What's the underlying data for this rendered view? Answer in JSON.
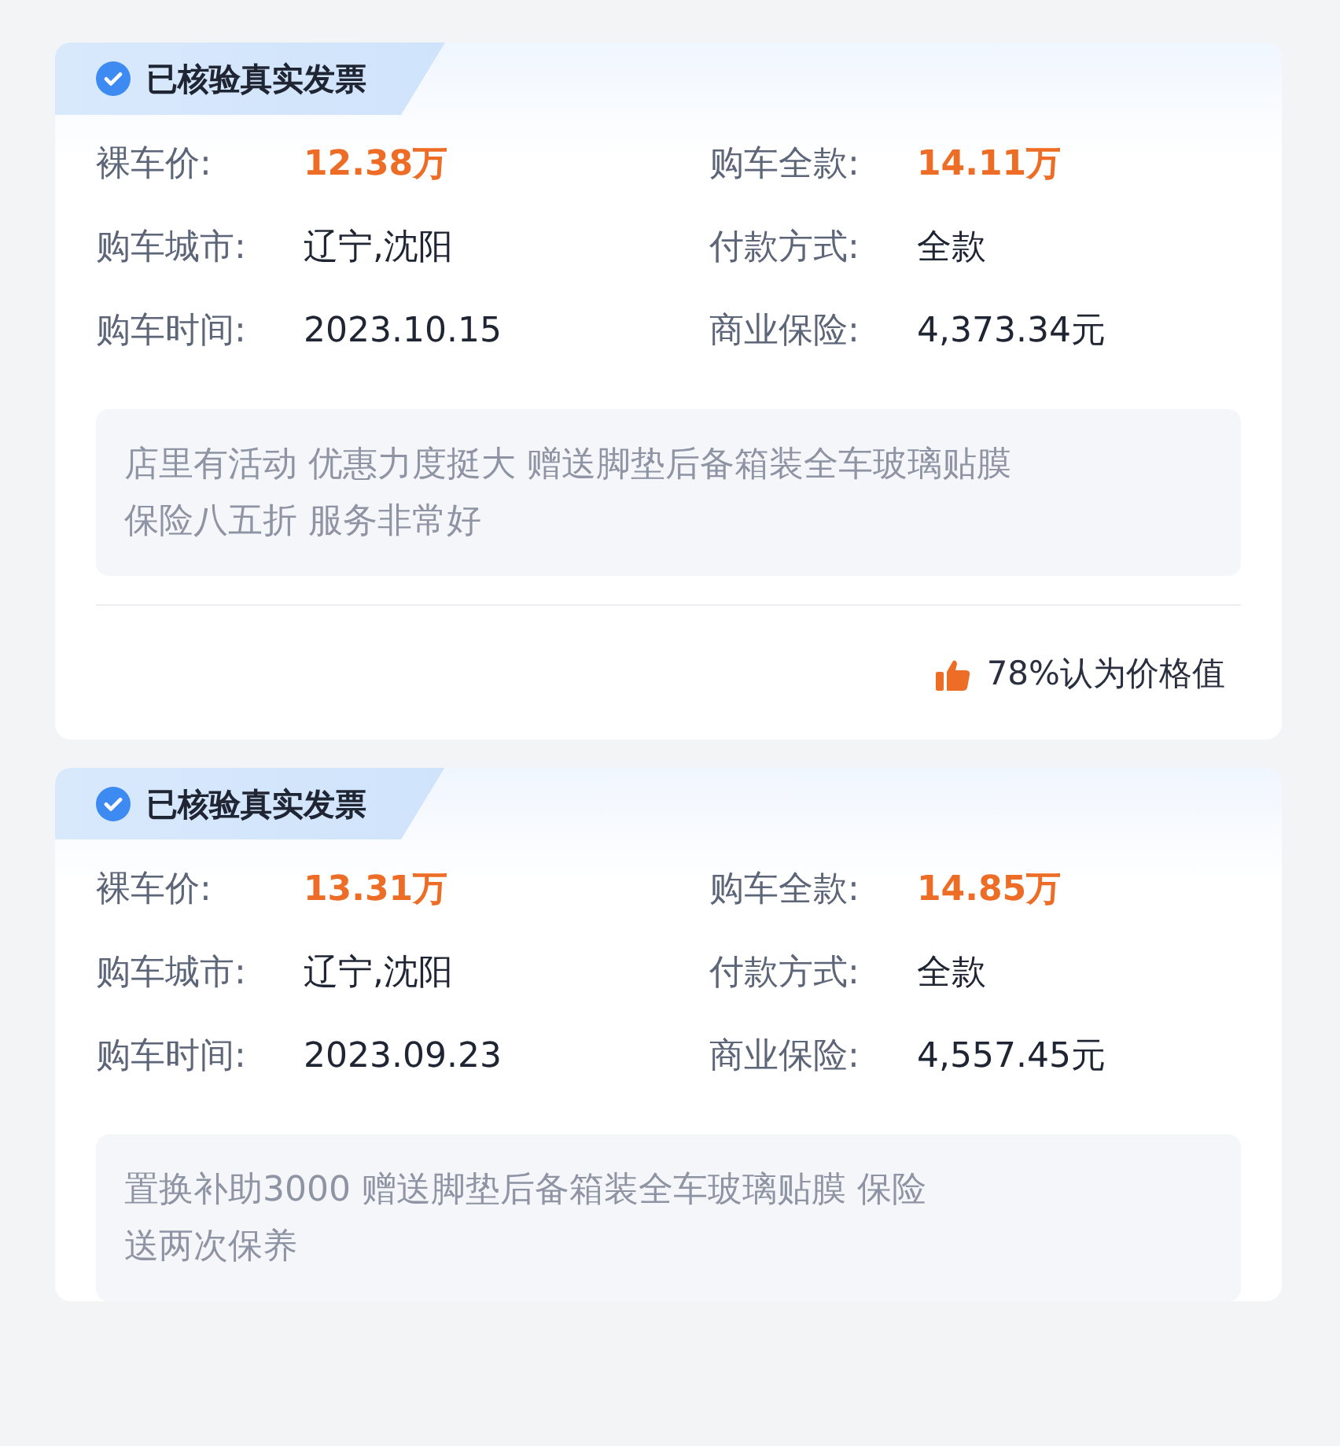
{
  "cards": [
    {
      "badge": "已核验真实发票",
      "fields": [
        {
          "label": "裸车价:",
          "value": "12.38万",
          "highlight": true
        },
        {
          "label": "购车全款:",
          "value": "14.11万",
          "highlight": true
        },
        {
          "label": "购车城市:",
          "value": "辽宁,沈阳",
          "highlight": false
        },
        {
          "label": "付款方式:",
          "value": "全款",
          "highlight": false
        },
        {
          "label": "购车时间:",
          "value": "2023.10.15",
          "highlight": false
        },
        {
          "label": "商业保险:",
          "value": "4,373.34元",
          "highlight": false
        }
      ],
      "comment_lines": [
        "店里有活动 优惠力度挺大 赠送脚垫后备箱装全车玻璃贴膜",
        "保险八五折  服务非常好"
      ],
      "worth": "78%认为价格值"
    },
    {
      "badge": "已核验真实发票",
      "fields": [
        {
          "label": "裸车价:",
          "value": "13.31万",
          "highlight": true
        },
        {
          "label": "购车全款:",
          "value": "14.85万",
          "highlight": true
        },
        {
          "label": "购车城市:",
          "value": "辽宁,沈阳",
          "highlight": false
        },
        {
          "label": "付款方式:",
          "value": "全款",
          "highlight": false
        },
        {
          "label": "购车时间:",
          "value": "2023.09.23",
          "highlight": false
        },
        {
          "label": "商业保险:",
          "value": "4,557.45元",
          "highlight": false
        }
      ],
      "comment_lines": [
        "置换补助3000 赠送脚垫后备箱装全车玻璃贴膜 保险",
        "送两次保养"
      ]
    }
  ]
}
